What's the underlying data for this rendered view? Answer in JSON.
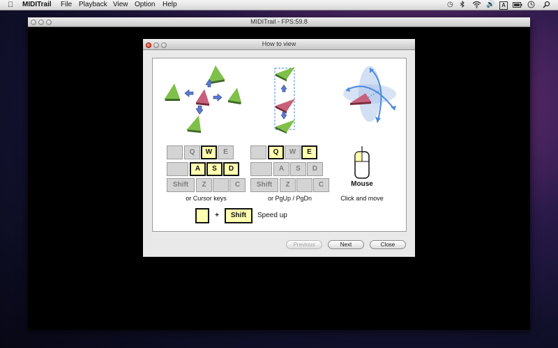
{
  "menubar": {
    "app_name": "MIDITrail",
    "items": [
      "File",
      "Playback",
      "View",
      "Option",
      "Help"
    ],
    "apple_icon": "apple-icon",
    "status_icons": [
      "time-machine-icon",
      "bluetooth-icon",
      "wifi-icon",
      "volume-icon",
      "input-menu-icon",
      "battery-icon",
      "clock-icon",
      "spotlight-icon"
    ],
    "input_menu_glyph": "A"
  },
  "main_window": {
    "title": "MIDITrail - FPS:59.8"
  },
  "dialog": {
    "title": "How to view",
    "diagrams": [
      "move-diagram",
      "updown-diagram",
      "rotate-diagram"
    ],
    "keyboard_left": {
      "row1": [
        "",
        "Q",
        "W",
        "E"
      ],
      "row2": [
        "",
        "A",
        "S",
        "D"
      ],
      "row3": [
        "Shift",
        "Z",
        "",
        "C"
      ],
      "caption": "or Cursor keys"
    },
    "keyboard_right": {
      "row1": [
        "",
        "Q",
        "W",
        "E"
      ],
      "row2": [
        "",
        "A",
        "S",
        "D"
      ],
      "row3": [
        "Shift",
        "Z",
        "",
        "C"
      ],
      "caption": "or PgUp / PgDn"
    },
    "mouse": {
      "label": "Mouse",
      "caption": "Click and move"
    },
    "speed": {
      "plus": "+",
      "shift_key": "Shift",
      "caption": "Speed up"
    },
    "buttons": {
      "previous": "Previous",
      "next": "Next",
      "close": "Close"
    }
  },
  "colors": {
    "highlight_key": "#ffffb0",
    "key_gray": "#d4d4d4",
    "triangle_green": "#7fc04a",
    "triangle_red": "#c7607a",
    "arrow_blue": "#5a7ad0",
    "rotate_blue": "#4a8ae0"
  }
}
